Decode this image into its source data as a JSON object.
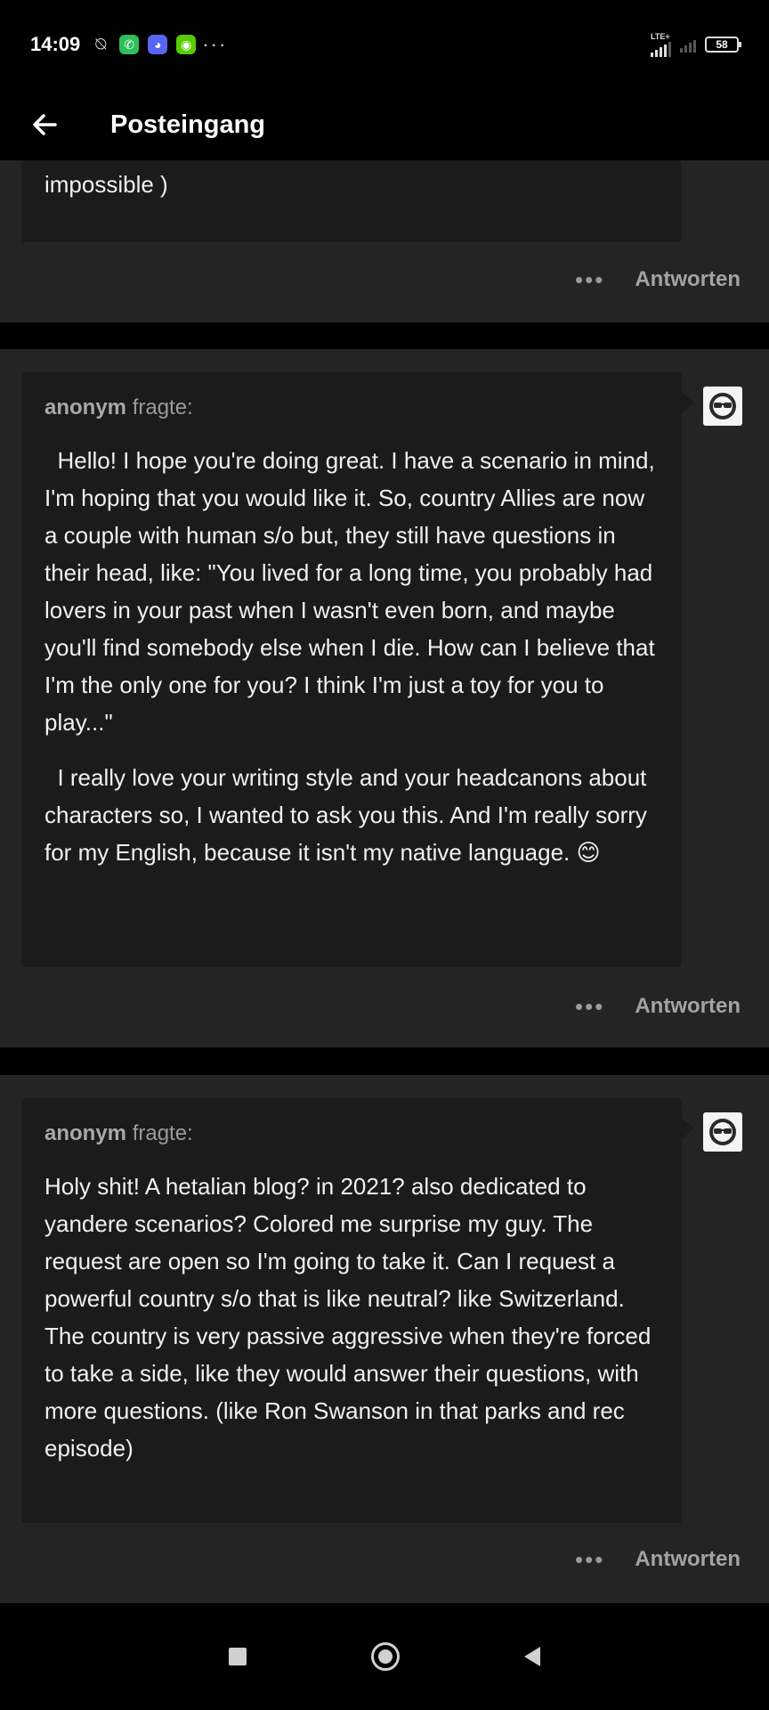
{
  "status": {
    "time": "14:09",
    "battery": "58",
    "network": "LTE+"
  },
  "appbar": {
    "title": "Posteingang"
  },
  "posts": [
    {
      "text_end": "impossible )",
      "more_icon": "•••",
      "reply_label": "Antworten"
    },
    {
      "asker_name": "anonym",
      "asker_verb": "fragte:",
      "paragraphs": [
        "  Hello! I hope you're doing great. I have a scenario in mind, I'm hoping that you would like it. So, country Allies are now a couple with human s/o but, they still have questions in their head, like: \"You lived for a long time, you probably had lovers in your past when I wasn't even born, and maybe you'll find somebody else when I die. How can I believe that I'm the only one for you? I think I'm just a toy for you to play...\"",
        "  I really love your writing style and your headcanons about characters so, I wanted to ask you this. And I'm really sorry for my English, because it isn't my native language. 😊"
      ],
      "more_icon": "•••",
      "reply_label": "Antworten"
    },
    {
      "asker_name": "anonym",
      "asker_verb": "fragte:",
      "paragraphs": [
        "Holy shit! A hetalian blog? in 2021? also dedicated to yandere scenarios? Colored me surprise my guy. The request are open so I'm going to take it. Can I request a powerful country s/o that is like neutral? like Switzerland. The country is very passive aggressive when they're forced to take a side, like they would answer their questions, with more questions. (like Ron Swanson in that parks and rec episode)"
      ],
      "more_icon": "•••",
      "reply_label": "Antworten"
    }
  ],
  "colors": {
    "background": "#000000",
    "card": "#242424",
    "bubble": "#1b1b1b",
    "text": "#f0f0f0",
    "muted": "#9a9a9a"
  },
  "icons": {
    "back": "arrow-left-icon",
    "avatar": "anon-sunglasses-avatar",
    "more": "more-horizontal-icon"
  }
}
